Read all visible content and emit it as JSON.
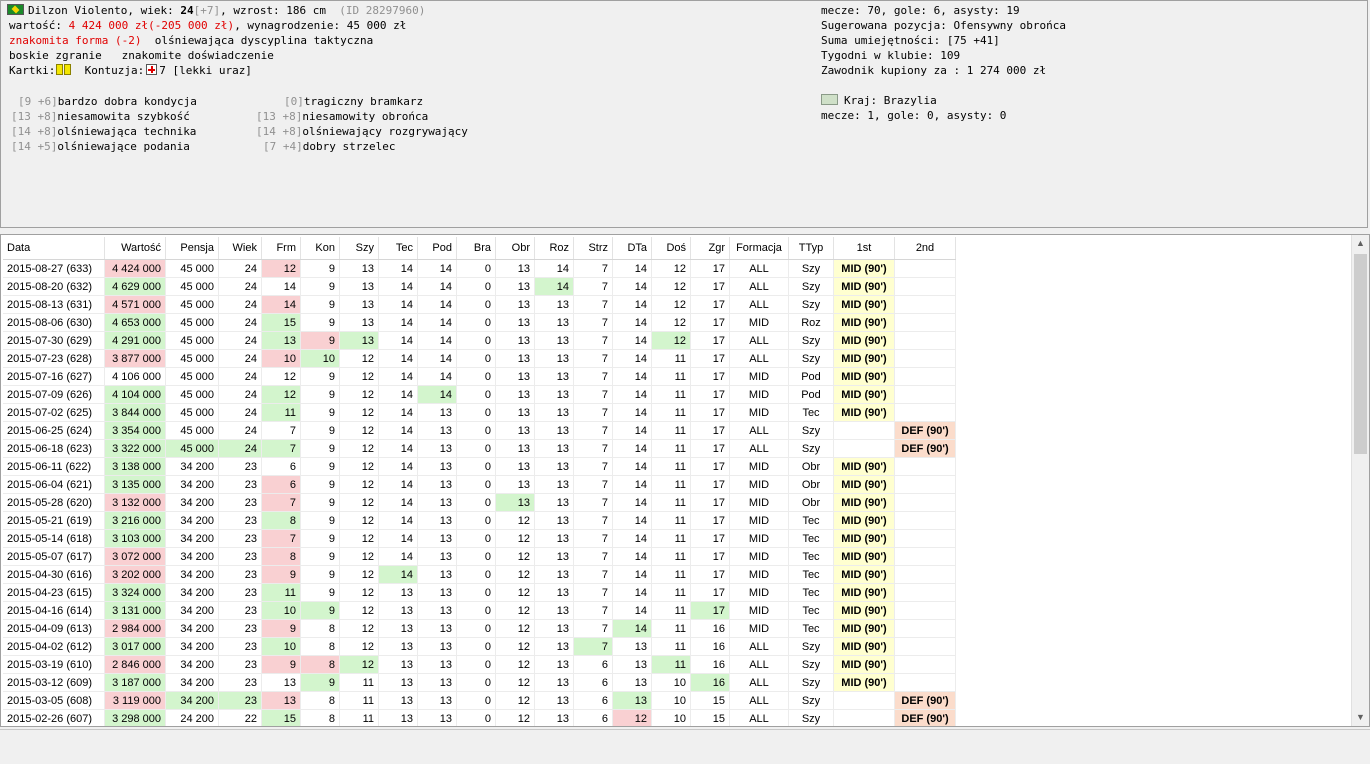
{
  "player": {
    "line1_name": "Dilzon Violento, wiek: ",
    "line1_age": "24",
    "line1_age_delta": "[+7]",
    "line1_height": ", wzrost: 186 cm",
    "line1_id": "(ID 28297960)",
    "line2_label": "wartość: ",
    "line2_value": "4 424 000 zł(-205 000 zł)",
    "line2_salary": ", wynagrodzenie: 45 000 zł",
    "line3_form": "znakomita forma (-2)",
    "line3_discipline": "  olśniewająca dyscyplina taktyczna",
    "line4": "boskie zgranie   znakomite doświadczenie",
    "line5_cards": "Kartki:",
    "line5_injury_label": "Kontuzja:",
    "line5_injury_value": "7 [lekki uraz]"
  },
  "skills": [
    {
      "val": "[9 +6]",
      "name": "bardzo dobra kondycja"
    },
    {
      "val": "[13 +8]",
      "name": "niesamowita szybkość"
    },
    {
      "val": "[14 +8]",
      "name": "olśniewająca technika"
    },
    {
      "val": "[14 +5]",
      "name": "olśniewające podania"
    },
    {
      "val": "[0]",
      "name": "tragiczny bramkarz"
    },
    {
      "val": "[13 +8]",
      "name": "niesamowity obrońca"
    },
    {
      "val": "[14 +8]",
      "name": "olśniewający rozgrywający"
    },
    {
      "val": "[7 +4]",
      "name": "dobry strzelec"
    }
  ],
  "right_info": {
    "stats": "mecze: 70, gole: 6, asysty: 19",
    "position": "Sugerowana pozycja: Ofensywny obrońca",
    "skill_sum": "Suma umiejętności: [75 +41]",
    "weeks": "Tygodni w klubie: 109",
    "bought": "Zawodnik kupiony za : 1 274 000 zł",
    "country": "Kraj: Brazylia",
    "country_stats": "mecze: 1, gole: 0, asysty: 0"
  },
  "table": {
    "columns": [
      "Data",
      "Wartość",
      "Pensja",
      "Wiek",
      "Frm",
      "Kon",
      "Szy",
      "Tec",
      "Pod",
      "Bra",
      "Obr",
      "Roz",
      "Strz",
      "DTa",
      "Doś",
      "Zgr",
      "Formacja",
      "TTyp",
      "1st",
      "2nd"
    ],
    "rows": [
      [
        "2015-08-27 (633)",
        "4 424 000",
        "45 000",
        "24",
        "12",
        "9",
        "13",
        "14",
        "14",
        "0",
        "13",
        "14",
        "7",
        "14",
        "12",
        "17",
        "ALL",
        "Szy",
        "MID (90')",
        ""
      ],
      [
        "2015-08-20 (632)",
        "4 629 000",
        "45 000",
        "24",
        "14",
        "9",
        "13",
        "14",
        "14",
        "0",
        "13",
        "14",
        "7",
        "14",
        "12",
        "17",
        "ALL",
        "Szy",
        "MID (90')",
        ""
      ],
      [
        "2015-08-13 (631)",
        "4 571 000",
        "45 000",
        "24",
        "14",
        "9",
        "13",
        "14",
        "14",
        "0",
        "13",
        "13",
        "7",
        "14",
        "12",
        "17",
        "ALL",
        "Szy",
        "MID (90')",
        ""
      ],
      [
        "2015-08-06 (630)",
        "4 653 000",
        "45 000",
        "24",
        "15",
        "9",
        "13",
        "14",
        "14",
        "0",
        "13",
        "13",
        "7",
        "14",
        "12",
        "17",
        "MID",
        "Roz",
        "MID (90')",
        ""
      ],
      [
        "2015-07-30 (629)",
        "4 291 000",
        "45 000",
        "24",
        "13",
        "9",
        "13",
        "14",
        "14",
        "0",
        "13",
        "13",
        "7",
        "14",
        "12",
        "17",
        "ALL",
        "Szy",
        "MID (90')",
        ""
      ],
      [
        "2015-07-23 (628)",
        "3 877 000",
        "45 000",
        "24",
        "10",
        "10",
        "12",
        "14",
        "14",
        "0",
        "13",
        "13",
        "7",
        "14",
        "11",
        "17",
        "ALL",
        "Szy",
        "MID (90')",
        ""
      ],
      [
        "2015-07-16 (627)",
        "4 106 000",
        "45 000",
        "24",
        "12",
        "9",
        "12",
        "14",
        "14",
        "0",
        "13",
        "13",
        "7",
        "14",
        "11",
        "17",
        "MID",
        "Pod",
        "MID (90')",
        ""
      ],
      [
        "2015-07-09 (626)",
        "4 104 000",
        "45 000",
        "24",
        "12",
        "9",
        "12",
        "14",
        "14",
        "0",
        "13",
        "13",
        "7",
        "14",
        "11",
        "17",
        "MID",
        "Pod",
        "MID (90')",
        ""
      ],
      [
        "2015-07-02 (625)",
        "3 844 000",
        "45 000",
        "24",
        "11",
        "9",
        "12",
        "14",
        "13",
        "0",
        "13",
        "13",
        "7",
        "14",
        "11",
        "17",
        "MID",
        "Tec",
        "MID (90')",
        ""
      ],
      [
        "2015-06-25 (624)",
        "3 354 000",
        "45 000",
        "24",
        "7",
        "9",
        "12",
        "14",
        "13",
        "0",
        "13",
        "13",
        "7",
        "14",
        "11",
        "17",
        "ALL",
        "Szy",
        "",
        "DEF (90')"
      ],
      [
        "2015-06-18 (623)",
        "3 322 000",
        "45 000",
        "24",
        "7",
        "9",
        "12",
        "14",
        "13",
        "0",
        "13",
        "13",
        "7",
        "14",
        "11",
        "17",
        "ALL",
        "Szy",
        "",
        "DEF (90')"
      ],
      [
        "2015-06-11 (622)",
        "3 138 000",
        "34 200",
        "23",
        "6",
        "9",
        "12",
        "14",
        "13",
        "0",
        "13",
        "13",
        "7",
        "14",
        "11",
        "17",
        "MID",
        "Obr",
        "MID (90')",
        ""
      ],
      [
        "2015-06-04 (621)",
        "3 135 000",
        "34 200",
        "23",
        "6",
        "9",
        "12",
        "14",
        "13",
        "0",
        "13",
        "13",
        "7",
        "14",
        "11",
        "17",
        "MID",
        "Obr",
        "MID (90')",
        ""
      ],
      [
        "2015-05-28 (620)",
        "3 132 000",
        "34 200",
        "23",
        "7",
        "9",
        "12",
        "14",
        "13",
        "0",
        "13",
        "13",
        "7",
        "14",
        "11",
        "17",
        "MID",
        "Obr",
        "MID (90')",
        ""
      ],
      [
        "2015-05-21 (619)",
        "3 216 000",
        "34 200",
        "23",
        "8",
        "9",
        "12",
        "14",
        "13",
        "0",
        "12",
        "13",
        "7",
        "14",
        "11",
        "17",
        "MID",
        "Tec",
        "MID (90')",
        ""
      ],
      [
        "2015-05-14 (618)",
        "3 103 000",
        "34 200",
        "23",
        "7",
        "9",
        "12",
        "14",
        "13",
        "0",
        "12",
        "13",
        "7",
        "14",
        "11",
        "17",
        "MID",
        "Tec",
        "MID (90')",
        ""
      ],
      [
        "2015-05-07 (617)",
        "3 072 000",
        "34 200",
        "23",
        "8",
        "9",
        "12",
        "14",
        "13",
        "0",
        "12",
        "13",
        "7",
        "14",
        "11",
        "17",
        "MID",
        "Tec",
        "MID (90')",
        ""
      ],
      [
        "2015-04-30 (616)",
        "3 202 000",
        "34 200",
        "23",
        "9",
        "9",
        "12",
        "14",
        "13",
        "0",
        "12",
        "13",
        "7",
        "14",
        "11",
        "17",
        "MID",
        "Tec",
        "MID (90')",
        ""
      ],
      [
        "2015-04-23 (615)",
        "3 324 000",
        "34 200",
        "23",
        "11",
        "9",
        "12",
        "13",
        "13",
        "0",
        "12",
        "13",
        "7",
        "14",
        "11",
        "17",
        "MID",
        "Tec",
        "MID (90')",
        ""
      ],
      [
        "2015-04-16 (614)",
        "3 131 000",
        "34 200",
        "23",
        "10",
        "9",
        "12",
        "13",
        "13",
        "0",
        "12",
        "13",
        "7",
        "14",
        "11",
        "17",
        "MID",
        "Tec",
        "MID (90')",
        ""
      ],
      [
        "2015-04-09 (613)",
        "2 984 000",
        "34 200",
        "23",
        "9",
        "8",
        "12",
        "13",
        "13",
        "0",
        "12",
        "13",
        "7",
        "14",
        "11",
        "16",
        "MID",
        "Tec",
        "MID (90')",
        ""
      ],
      [
        "2015-04-02 (612)",
        "3 017 000",
        "34 200",
        "23",
        "10",
        "8",
        "12",
        "13",
        "13",
        "0",
        "12",
        "13",
        "7",
        "13",
        "11",
        "16",
        "ALL",
        "Szy",
        "MID (90')",
        ""
      ],
      [
        "2015-03-19 (610)",
        "2 846 000",
        "34 200",
        "23",
        "9",
        "8",
        "12",
        "13",
        "13",
        "0",
        "12",
        "13",
        "6",
        "13",
        "11",
        "16",
        "ALL",
        "Szy",
        "MID (90')",
        ""
      ],
      [
        "2015-03-12 (609)",
        "3 187 000",
        "34 200",
        "23",
        "13",
        "9",
        "11",
        "13",
        "13",
        "0",
        "12",
        "13",
        "6",
        "13",
        "10",
        "16",
        "ALL",
        "Szy",
        "MID (90')",
        ""
      ],
      [
        "2015-03-05 (608)",
        "3 119 000",
        "34 200",
        "23",
        "13",
        "8",
        "11",
        "13",
        "13",
        "0",
        "12",
        "13",
        "6",
        "13",
        "10",
        "15",
        "ALL",
        "Szy",
        "",
        "DEF (90')"
      ],
      [
        "2015-02-26 (607)",
        "3 298 000",
        "24 200",
        "22",
        "15",
        "8",
        "11",
        "13",
        "13",
        "0",
        "12",
        "13",
        "6",
        "12",
        "10",
        "15",
        "ALL",
        "Szy",
        "",
        "DEF (90')"
      ]
    ],
    "highlights": {
      "0": {
        "1": "rd",
        "4": "rd"
      },
      "1": {
        "1": "gr",
        "11": "gr"
      },
      "2": {
        "1": "rd",
        "4": "rd"
      },
      "3": {
        "1": "gr",
        "4": "gr"
      },
      "4": {
        "1": "gr",
        "4": "gr",
        "5": "rd",
        "6": "gr",
        "14": "gr"
      },
      "5": {
        "1": "rd",
        "4": "rd",
        "5": "gr"
      },
      "7": {
        "1": "gr",
        "4": "gr",
        "8": "gr"
      },
      "8": {
        "1": "gr",
        "4": "gr"
      },
      "9": {
        "1": "gr"
      },
      "10": {
        "1": "gr",
        "2": "gr",
        "3": "gr",
        "4": "gr"
      },
      "11": {
        "1": "gr"
      },
      "12": {
        "1": "gr",
        "4": "rd"
      },
      "13": {
        "1": "rd",
        "4": "rd",
        "10": "gr"
      },
      "14": {
        "1": "gr",
        "4": "gr"
      },
      "15": {
        "1": "gr",
        "4": "rd"
      },
      "16": {
        "1": "rd",
        "4": "rd"
      },
      "17": {
        "1": "rd",
        "4": "rd",
        "7": "gr"
      },
      "18": {
        "1": "gr",
        "4": "gr"
      },
      "19": {
        "1": "gr",
        "4": "gr",
        "5": "gr",
        "15": "gr"
      },
      "20": {
        "1": "rd",
        "4": "rd",
        "13": "gr"
      },
      "21": {
        "1": "gr",
        "4": "gr",
        "12": "gr"
      },
      "22": {
        "1": "rd",
        "4": "rd",
        "5": "rd",
        "6": "gr",
        "14": "gr"
      },
      "23": {
        "1": "gr",
        "5": "gr",
        "15": "gr"
      },
      "24": {
        "1": "rd",
        "2": "gr",
        "3": "gr",
        "4": "rd",
        "13": "gr"
      },
      "25": {
        "1": "gr",
        "4": "gr",
        "13": "rd"
      }
    }
  },
  "colors": {
    "highlight_green": "#d3f5cd",
    "highlight_red": "#f9d0d2",
    "mid_yellow": "#ffffd0",
    "def_orange": "#fbdccb"
  },
  "icons": {
    "scroll_up": "▲",
    "scroll_down": "▼"
  }
}
